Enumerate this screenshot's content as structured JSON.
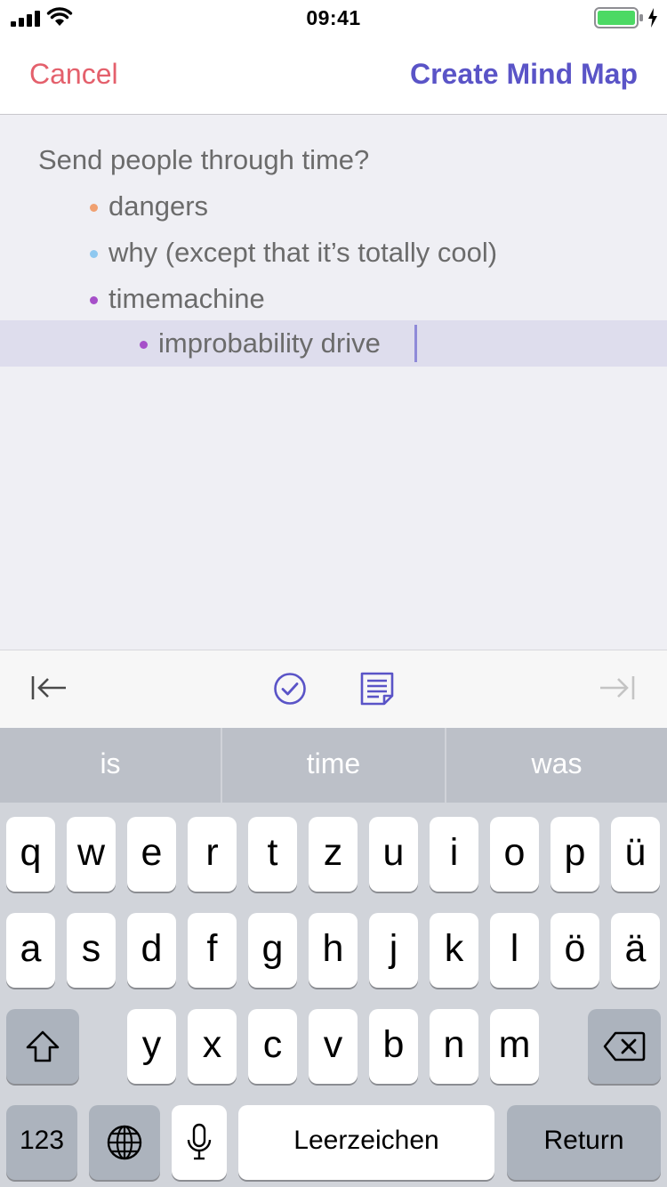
{
  "status": {
    "time": "09:41",
    "signal_icon": "cellular-signal-icon",
    "wifi_icon": "wifi-icon",
    "battery_icon": "battery-icon",
    "charging_icon": "charging-bolt-icon",
    "battery_level": 1.0,
    "battery_color": "#4cd964"
  },
  "nav": {
    "cancel_label": "Cancel",
    "create_label": "Create Mind Map",
    "cancel_color": "#e4606c",
    "create_color": "#5a54c7"
  },
  "outline": {
    "root": "Send people through time?",
    "items": [
      {
        "text": "dangers",
        "bullet_color": "#f0a070"
      },
      {
        "text": "why (except that it’s totally cool)",
        "bullet_color": "#8ec8f0"
      },
      {
        "text": "timemachine",
        "bullet_color": "#a64fc9"
      },
      {
        "text": "improbability drive",
        "bullet_color": "#a64fc9"
      }
    ]
  },
  "toolbar": {
    "outdent_icon": "outdent-icon",
    "check_icon": "checkmark-circle-icon",
    "note_icon": "note-icon",
    "indent_icon": "indent-icon",
    "accent_color": "#5a54c7"
  },
  "keyboard": {
    "suggestions": [
      "is",
      "time",
      "was"
    ],
    "row1": [
      "q",
      "w",
      "e",
      "r",
      "t",
      "z",
      "u",
      "i",
      "o",
      "p",
      "ü"
    ],
    "row2": [
      "a",
      "s",
      "d",
      "f",
      "g",
      "h",
      "j",
      "k",
      "l",
      "ö",
      "ä"
    ],
    "row3": [
      "y",
      "x",
      "c",
      "v",
      "b",
      "n",
      "m"
    ],
    "shift_icon": "shift-icon",
    "delete_icon": "delete-icon",
    "numbers_label": "123",
    "globe_icon": "globe-icon",
    "mic_icon": "microphone-icon",
    "space_label": "Leerzeichen",
    "return_label": "Return"
  }
}
